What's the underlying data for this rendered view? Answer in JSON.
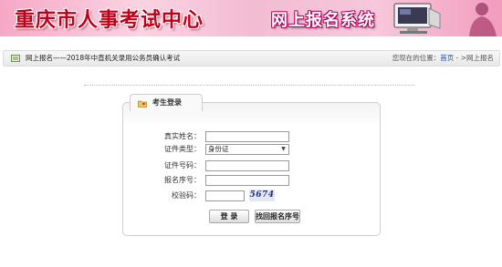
{
  "banner": {
    "title": "重庆市人事考试中心",
    "system_name": "网上报名系统"
  },
  "breadcrumb": {
    "section": "网上报名",
    "separator": "——",
    "exam_title": "2018年中直机关录用公务员确认考试",
    "location_label": "您现在的位置：",
    "home_link": "首页",
    "arrow": " - >",
    "current_page": "网上报名"
  },
  "login": {
    "tab_title": "考生登录",
    "fields": {
      "name_label": "真实姓名：",
      "name_value": "",
      "id_type_label": "证件类型：",
      "id_type_selected": "身份证",
      "id_number_label": "证件号码：",
      "id_number_value": "",
      "reg_number_label": "报名序号：",
      "reg_number_value": "",
      "captcha_label": "校验码：",
      "captcha_value": "",
      "captcha_image_text": "5674"
    },
    "login_button": "登 录",
    "retrieve_button": "找回报名序号"
  },
  "colors": {
    "banner_title": "#c0001a",
    "banner_bg_pink": "#f6a8c5",
    "link_blue": "#1a4fa0",
    "captcha_text": "#1d2f8a"
  },
  "icons": {
    "crumb_icon": "form-icon",
    "tab_icon": "folder-user-icon",
    "select_arrow": "chevron-down-icon"
  }
}
